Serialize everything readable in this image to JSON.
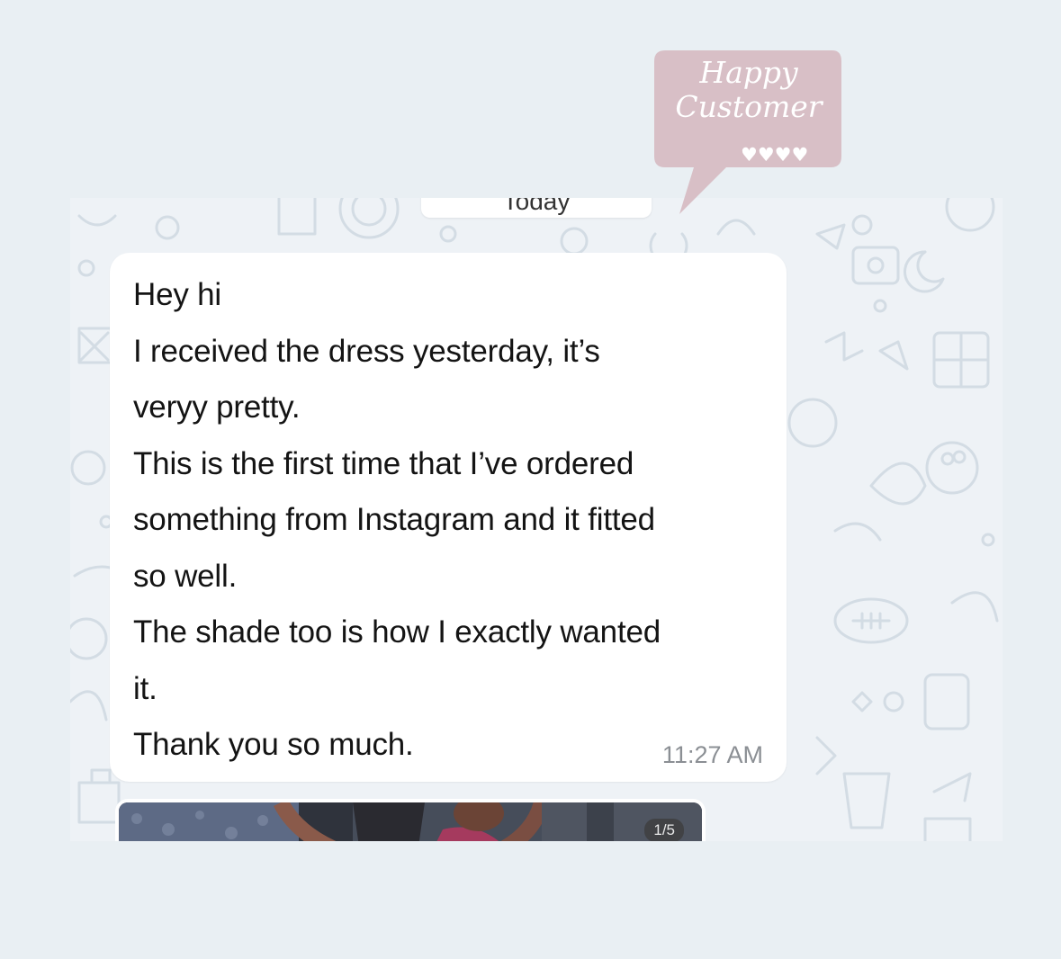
{
  "sticker": {
    "text_line1": "Happy",
    "text_line2": "Customer",
    "hearts": "♥♥♥♥",
    "color": "#d8bfc6"
  },
  "chat": {
    "date_label": "Today",
    "message": {
      "lines": [
        "Hey hi",
        "I received the dress yesterday, it’s",
        "veryy pretty.",
        "This is the first time that I’ve ordered",
        "something from Instagram and it fitted",
        "so well.",
        "The shade too is how I exactly wanted",
        "it.",
        "Thank you so much."
      ],
      "time": "11:27 AM"
    },
    "media": {
      "counter": "1/5"
    }
  },
  "colors": {
    "page_bg": "#e9eff3",
    "chat_bg": "#eef2f6",
    "bubble_bg": "#ffffff",
    "doodle": "#d3dce4"
  }
}
